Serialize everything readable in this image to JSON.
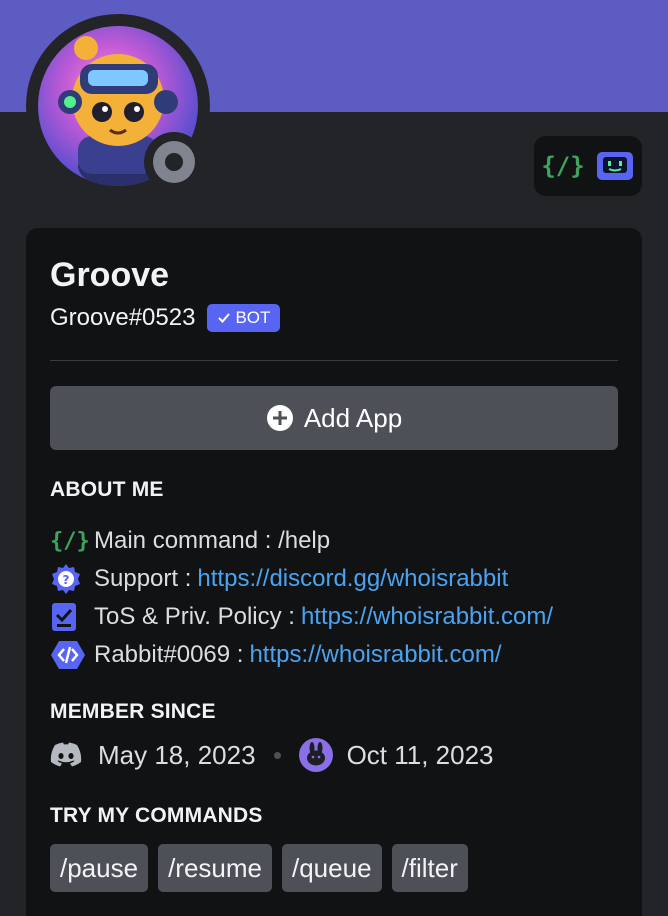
{
  "profile": {
    "display_name": "Groove",
    "username": "Groove#0523",
    "bot_tag": "BOT",
    "status": "offline"
  },
  "badges": [
    "slash-commands-badge",
    "active-developer-badge"
  ],
  "actions": {
    "add_app_label": "Add App"
  },
  "about": {
    "title": "ABOUT ME",
    "lines": [
      {
        "icon": "slash-command-icon",
        "text": "Main command : /help",
        "link": ""
      },
      {
        "icon": "help-icon",
        "text": "Support : ",
        "link": "https://discord.gg/whoisrabbit"
      },
      {
        "icon": "checklist-icon",
        "text": "ToS & Priv. Policy : ",
        "link": "https://whoisrabbit.com/"
      },
      {
        "icon": "code-icon",
        "text": "Rabbit#0069 : ",
        "link": "https://whoisrabbit.com/"
      }
    ]
  },
  "member_since": {
    "title": "MEMBER SINCE",
    "discord_date": "May 18, 2023",
    "server_date": "Oct 11, 2023"
  },
  "commands": {
    "title": "TRY MY COMMANDS",
    "items": [
      "/pause",
      "/resume",
      "/queue",
      "/filter"
    ]
  },
  "colors": {
    "banner": "#5c5cc2",
    "background": "#232428",
    "card": "#111214",
    "bot_tag": "#5865f2",
    "link": "#4aa3f0",
    "button": "#4e5058"
  }
}
